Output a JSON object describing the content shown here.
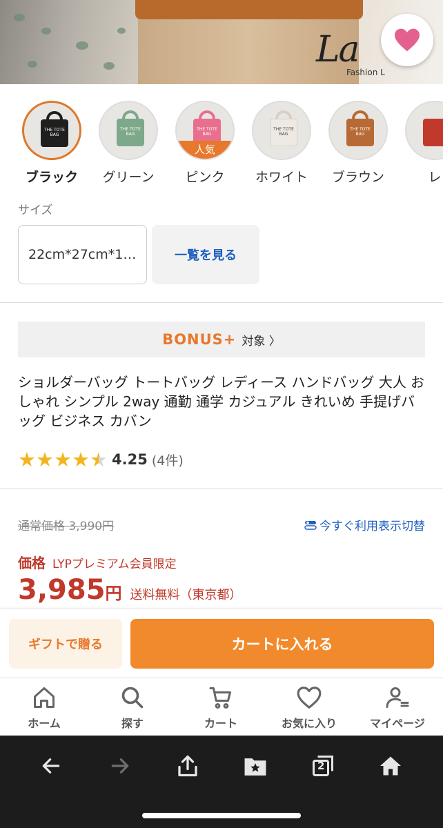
{
  "hero": {
    "brand_text": "La",
    "brand_sub": "Fashion L"
  },
  "colors": {
    "accent": "#e8782c",
    "price_red": "#c0392b",
    "link_blue": "#1e5fbf",
    "star": "#f3b51d"
  },
  "swatches": [
    {
      "label": "ブラック",
      "bag_color": "#1f1f1f",
      "tote": "THE TOTE BAG",
      "selected": true,
      "badge": ""
    },
    {
      "label": "グリーン",
      "bag_color": "#7ea88a",
      "tote": "THE TOTE BAG",
      "selected": false,
      "badge": ""
    },
    {
      "label": "ピンク",
      "bag_color": "#e86f8e",
      "tote": "THE TOTE BAG",
      "selected": false,
      "badge": "人気"
    },
    {
      "label": "ホワイト",
      "bag_color": "#eeeae3",
      "tote": "THE TOTE BAG",
      "selected": false,
      "badge": ""
    },
    {
      "label": "ブラウン",
      "bag_color": "#b76a35",
      "tote": "THE TOTE BAG",
      "selected": false,
      "badge": ""
    },
    {
      "label": "レ",
      "bag_color": "#c0392b",
      "tote": "",
      "selected": false,
      "badge": ""
    }
  ],
  "size": {
    "label": "サイズ",
    "value": "22cm*27cm*1…",
    "see_all": "一覧を見る"
  },
  "bonus": {
    "logo": "BONUS+",
    "text": "対象 〉"
  },
  "product": {
    "title": "ショルダーバッグ トートバッグ レディース ハンドバッグ 大人 おしゃれ シンプル 2way 通勤 通学 カジュアル きれいめ 手提げバッグ ビジネス カバン",
    "rating": 4.25,
    "rating_text": "4.25",
    "review_count": "(4件)"
  },
  "price": {
    "regular": "通常価格 3,990円",
    "toggle": "今すぐ利用表示切替",
    "label": "価格",
    "premium_note": "LYPプレミアム会員限定",
    "amount": "3,985",
    "yen": "円",
    "shipping": "送料無料（東京都）"
  },
  "actions": {
    "gift": "ギフトで贈る",
    "cart": "カートに入れる"
  },
  "tabs": [
    {
      "label": "ホーム",
      "icon": "home-icon"
    },
    {
      "label": "探す",
      "icon": "search-icon"
    },
    {
      "label": "カート",
      "icon": "cart-icon"
    },
    {
      "label": "お気に入り",
      "icon": "heart-icon"
    },
    {
      "label": "マイページ",
      "icon": "user-icon"
    }
  ],
  "browser": {
    "tab_count": "2"
  }
}
